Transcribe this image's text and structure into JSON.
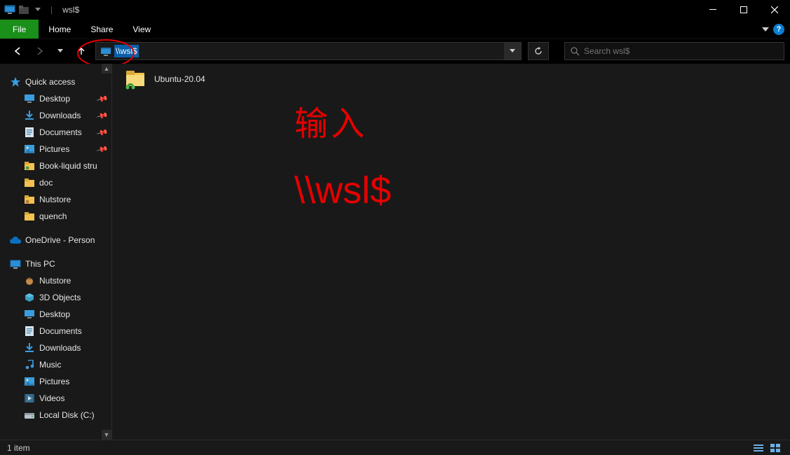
{
  "title": "wsl$",
  "ribbon": {
    "file": "File",
    "home": "Home",
    "share": "Share",
    "view": "View"
  },
  "address": {
    "value": "\\\\wsl$",
    "selected_display": "\\\\wsl$"
  },
  "search": {
    "placeholder": "Search wsl$"
  },
  "sidebar": {
    "quick_access": "Quick access",
    "qa_items": [
      {
        "label": "Desktop",
        "pinned": true,
        "icon": "desktop"
      },
      {
        "label": "Downloads",
        "pinned": true,
        "icon": "downloads"
      },
      {
        "label": "Documents",
        "pinned": true,
        "icon": "documents"
      },
      {
        "label": "Pictures",
        "pinned": true,
        "icon": "pictures"
      },
      {
        "label": "Book-liquid stru",
        "pinned": false,
        "icon": "folder-green"
      },
      {
        "label": "doc",
        "pinned": false,
        "icon": "folder"
      },
      {
        "label": "Nutstore",
        "pinned": false,
        "icon": "folder-nut"
      },
      {
        "label": "quench",
        "pinned": false,
        "icon": "folder"
      }
    ],
    "onedrive": "OneDrive - Person",
    "this_pc": "This PC",
    "pc_items": [
      {
        "label": "Nutstore",
        "icon": "nut"
      },
      {
        "label": "3D Objects",
        "icon": "3d"
      },
      {
        "label": "Desktop",
        "icon": "desktop"
      },
      {
        "label": "Documents",
        "icon": "documents"
      },
      {
        "label": "Downloads",
        "icon": "downloads"
      },
      {
        "label": "Music",
        "icon": "music"
      },
      {
        "label": "Pictures",
        "icon": "pictures"
      },
      {
        "label": "Videos",
        "icon": "videos"
      },
      {
        "label": "Local Disk (C:)",
        "icon": "disk"
      }
    ]
  },
  "content": {
    "items": [
      {
        "label": "Ubuntu-20.04"
      }
    ]
  },
  "annotation": {
    "line1": "输入",
    "line2": "\\\\wsl$"
  },
  "status": {
    "text": "1 item"
  }
}
